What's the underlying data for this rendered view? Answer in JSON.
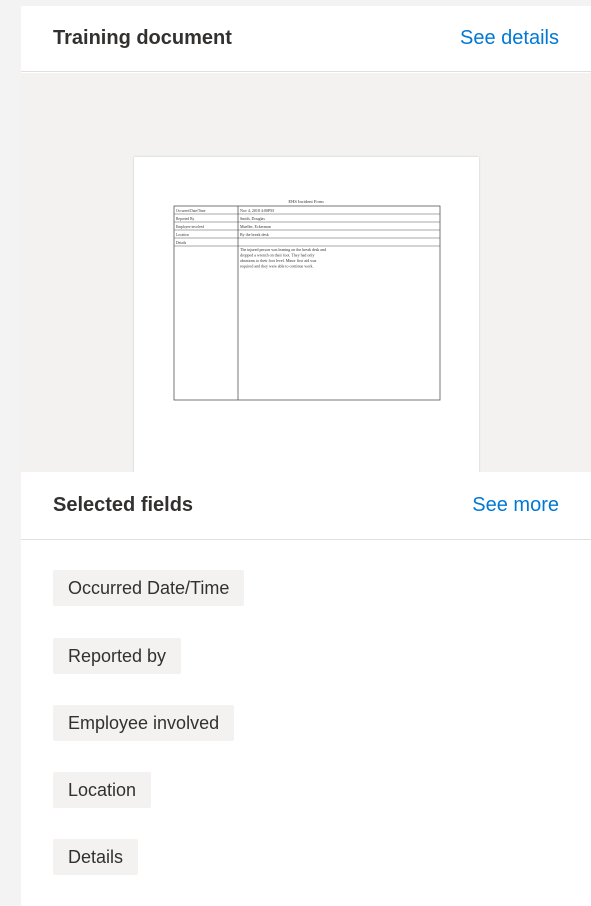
{
  "training_document": {
    "title": "Training document",
    "link_label": "See details",
    "preview": {
      "form_title": "EHS Incident Form",
      "rows": [
        {
          "label": "Occurred Date/Time",
          "value": "Nov 4, 2018 4:00PM"
        },
        {
          "label": "Reported By",
          "value": "Smith, Douglas"
        },
        {
          "label": "Employee involved",
          "value": "Mueller, Eckerman"
        },
        {
          "label": "Location",
          "value": "By the break desk"
        },
        {
          "label": "Details",
          "value": "The injured person was leaning on the break desk and dropped a wrench on their foot. They had only abrasions to their foot level. Minor first aid was required and they were able to continue work."
        }
      ]
    }
  },
  "selected_fields": {
    "title": "Selected fields",
    "link_label": "See more",
    "tags": [
      "Occurred Date/Time",
      "Reported by",
      "Employee involved",
      "Location",
      "Details"
    ]
  }
}
